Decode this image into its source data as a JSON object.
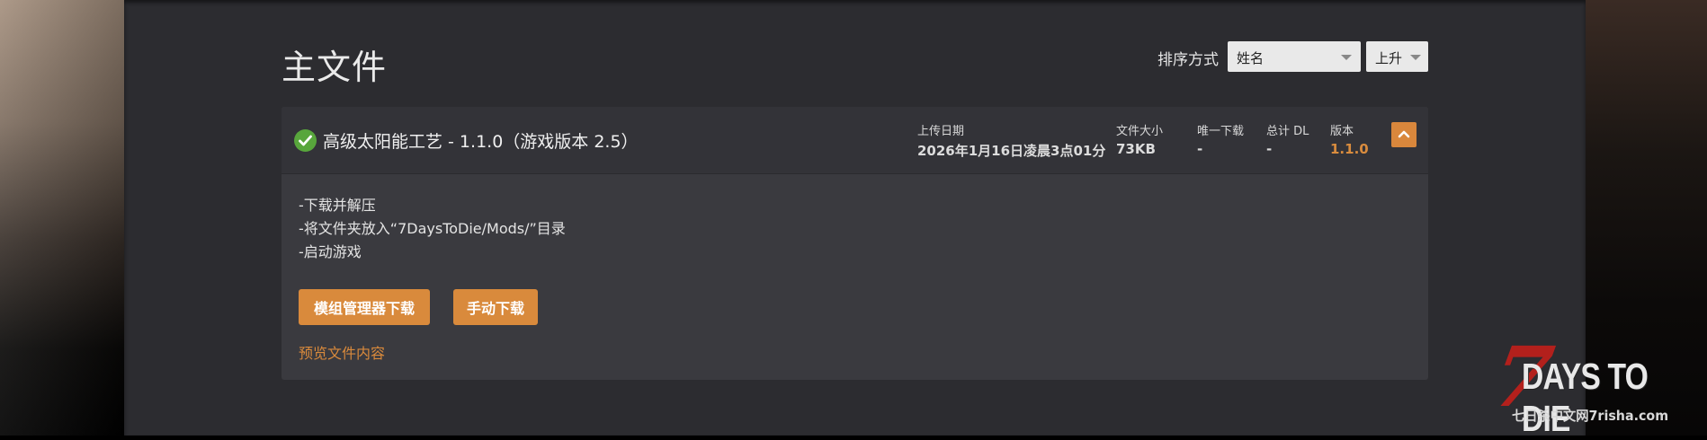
{
  "page": {
    "title": "主文件"
  },
  "sort": {
    "label": "排序方式",
    "field_value": "姓名",
    "order_value": "上升"
  },
  "file": {
    "title": "高级太阳能工艺 - 1.1.0（游戏版本 2.5）",
    "meta": {
      "upload_date_label": "上传日期",
      "upload_date_value": "2026年1月16日凌晨3点01分",
      "file_size_label": "文件大小",
      "file_size_value": "73KB",
      "unique_dl_label": "唯一下载",
      "unique_dl_value": "-",
      "total_dl_label": "总计 DL",
      "total_dl_value": "-",
      "version_label": "版本",
      "version_value": "1.1.0"
    },
    "description": [
      "-下载并解压",
      "-将文件夹放入“7DaysToDie/Mods/”目录",
      "-启动游戏"
    ],
    "buttons": {
      "mod_manager_download": "模组管理器下载",
      "manual_download": "手动下载"
    },
    "preview_link": "预览文件内容"
  },
  "logo": {
    "big_seven": "7",
    "title": "DAYS TO DIE",
    "subtitle": "七日杀中文网7risha.com"
  },
  "colors": {
    "accent": "#d98a3c",
    "success": "#58a63c",
    "panel_bg": "#2c2c30",
    "card_bg": "#3a3a3f"
  }
}
